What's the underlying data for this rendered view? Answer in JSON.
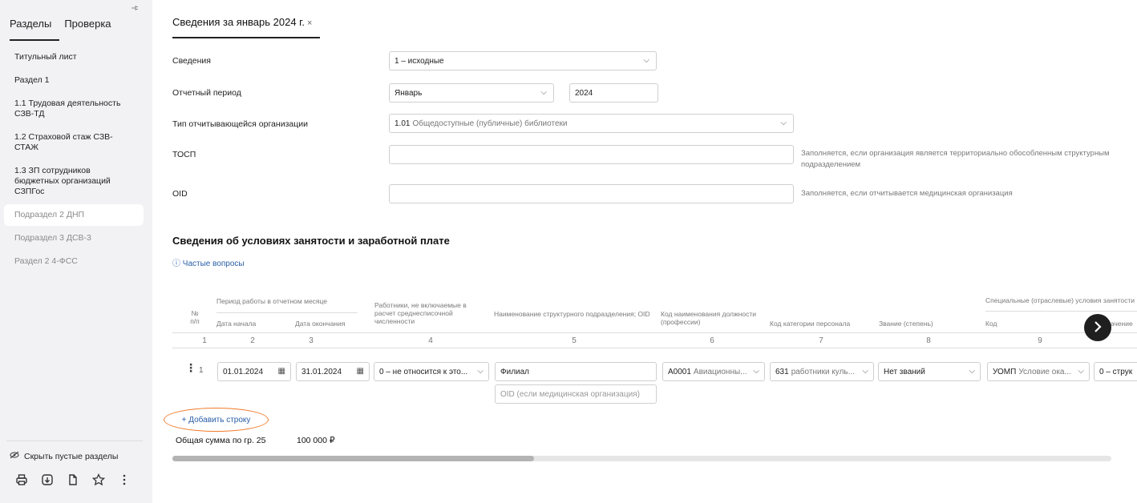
{
  "sidebar": {
    "tabs": [
      "Разделы",
      "Проверка"
    ],
    "pin_icon": "pin-icon",
    "items": [
      {
        "label": "Титульный лист",
        "state": "normal"
      },
      {
        "label": "Раздел 1",
        "state": "normal"
      },
      {
        "label": "1.1 Трудовая деятельность СЗВ-ТД",
        "state": "normal"
      },
      {
        "label": "1.2 Страховой стаж СЗВ-СТАЖ",
        "state": "normal"
      },
      {
        "label": "1.3 ЗП сотрудников бюджетных организаций СЗПГос",
        "state": "normal"
      },
      {
        "label": "Подраздел 2 ДНП",
        "state": "selected"
      },
      {
        "label": "Подраздел 3 ДСВ-3",
        "state": "muted"
      },
      {
        "label": "Раздел 2 4-ФСС",
        "state": "muted"
      }
    ],
    "hide_empty_label": "Скрыть пустые разделы",
    "tools": [
      "printer-icon",
      "download-icon",
      "copy-icon",
      "star-icon",
      "more-icon"
    ]
  },
  "document": {
    "tab_label": "Сведения за январь 2024 г.",
    "tab_close": "×"
  },
  "form": {
    "svedeniya_label": "Сведения",
    "svedeniya_value": "1 – исходные",
    "period_label": "Отчетный период",
    "period_month": "Январь",
    "period_year": "2024",
    "org_type_label": "Тип отчитывающейся организации",
    "org_type_code": "1.01",
    "org_type_value": "Общедоступные (публичные) библиотеки",
    "tosp_label": "ТОСП",
    "tosp_value": "",
    "tosp_hint": "Заполняется, если организация является территориально обособленным структурным подразделением",
    "oid_label": "OID",
    "oid_value": "",
    "oid_hint": "Заполняется, если отчитывается медицинская организация"
  },
  "section": {
    "title": "Сведения об условиях занятости и заработной плате",
    "faq_label": "Частые вопросы"
  },
  "table": {
    "header": {
      "num": "№ п/п",
      "period_group": "Период работы в отчетном месяце",
      "date_start": "Дата начала",
      "date_end": "Дата окончания",
      "excluded": "Работники, не включаемые в расчет среднесписочной численности",
      "subdivision": "Наименование структурного подразделения; OID",
      "position_code": "Код наименования должности (профессии)",
      "staff_category": "Код категории персонала",
      "rank": "Звание (степень)",
      "special_group": "Специальные (отраслевые) условия занятости",
      "special_code": "Код",
      "special_value": "Значение"
    },
    "column_numbers": [
      "1",
      "2",
      "3",
      "4",
      "5",
      "6",
      "7",
      "8",
      "9"
    ],
    "row": {
      "num": "1",
      "date_start": "01.01.2024",
      "date_end": "31.01.2024",
      "excluded": "0 – не относится к это...",
      "subdivision": "Филиал",
      "oid_placeholder": "OID (если медицинская организация)",
      "position_code": "A0001",
      "position_name": "Авиационны...",
      "staff_code": "631",
      "staff_name": "работники куль...",
      "rank": "Нет званий",
      "special_code": "УОМП",
      "special_name": "Условие ока...",
      "special_value": "0 – струк"
    },
    "add_row_label": "+ Добавить строку",
    "total_label": "Общая сумма по гр. 25",
    "total_value": "100 000 ₽",
    "scroll_fraction": 0.385
  }
}
